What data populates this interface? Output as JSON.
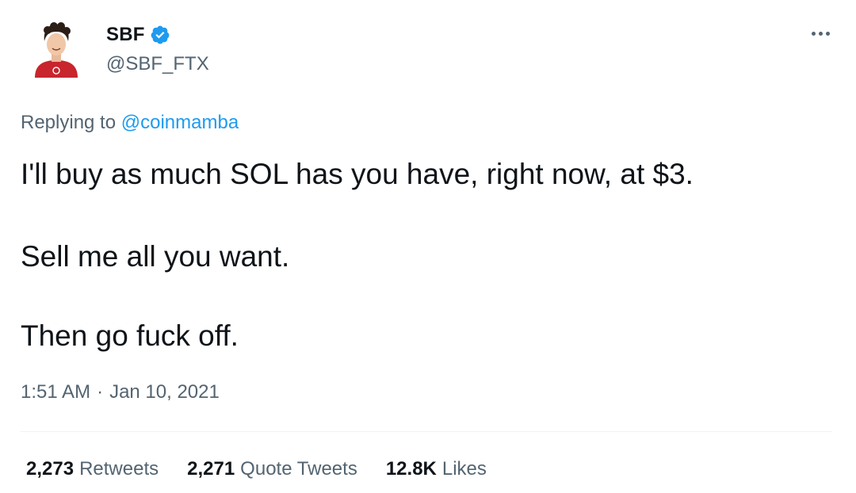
{
  "author": {
    "display_name": "SBF",
    "handle": "@SBF_FTX",
    "verified": true,
    "verified_color": "#1d9bf0"
  },
  "reply": {
    "prefix": "Replying to",
    "mention": "@coinmamba"
  },
  "body": {
    "line1": "I'll buy as much SOL has you have, right now, at $3.",
    "line2": "Sell me all you want.",
    "line3": "Then go fuck off."
  },
  "meta": {
    "time": "1:51 AM",
    "separator": "·",
    "date": "Jan 10, 2021"
  },
  "stats": {
    "retweets_count": "2,273",
    "retweets_label": "Retweets",
    "quotes_count": "2,271",
    "quotes_label": "Quote Tweets",
    "likes_count": "12.8K",
    "likes_label": "Likes"
  },
  "icons": {
    "more": "more-options-icon",
    "verified": "verified-badge-icon"
  },
  "colors": {
    "accent": "#1d9bf0",
    "text": "#0f1419",
    "secondary": "#536471"
  }
}
